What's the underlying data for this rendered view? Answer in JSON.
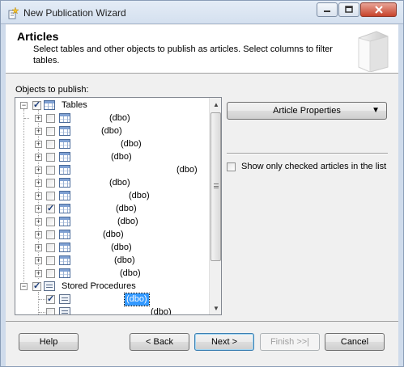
{
  "window": {
    "title": "New Publication Wizard",
    "controls": {
      "minimize": "minimize-icon",
      "maximize": "maximize-icon",
      "close": "close-icon"
    }
  },
  "header": {
    "title": "Articles",
    "description": "Select tables and other objects to publish as articles. Select columns to filter tables."
  },
  "objects_label": "Objects to publish:",
  "tree": {
    "tables_label": "Tables",
    "tables": [
      {
        "schema": "(dbo)",
        "checked": false
      },
      {
        "schema": "(dbo)",
        "checked": false
      },
      {
        "schema": "(dbo)",
        "checked": false
      },
      {
        "schema": "(dbo)",
        "checked": false
      },
      {
        "schema": "(dbo)",
        "checked": false
      },
      {
        "schema": "(dbo)",
        "checked": false
      },
      {
        "schema": "(dbo)",
        "checked": false
      },
      {
        "schema": "(dbo)",
        "checked": true
      },
      {
        "schema": "(dbo)",
        "checked": false
      },
      {
        "schema": "(dbo)",
        "checked": false
      },
      {
        "schema": "(dbo)",
        "checked": false
      },
      {
        "schema": "(dbo)",
        "checked": false
      },
      {
        "schema": "(dbo)",
        "checked": false
      }
    ],
    "procs_label": "Stored Procedures",
    "procs": [
      {
        "schema": "(dbo)",
        "checked": true,
        "selected": true
      },
      {
        "schema": "(dbo)",
        "checked": false,
        "selected": false
      }
    ]
  },
  "article_properties_label": "Article Properties",
  "show_only_checked_label": "Show only checked articles in the list",
  "buttons": {
    "help": "Help",
    "back": "< Back",
    "next": "Next >",
    "finish": "Finish >>|",
    "cancel": "Cancel"
  }
}
